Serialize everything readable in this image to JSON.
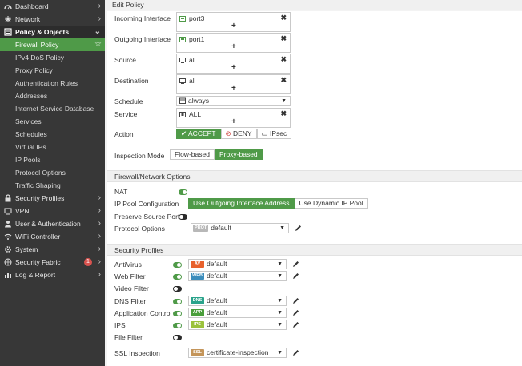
{
  "sidebar": {
    "items": [
      {
        "label": "Dashboard",
        "kind": "top",
        "icon": "dashboard-icon"
      },
      {
        "label": "Network",
        "kind": "top",
        "icon": "network-icon"
      },
      {
        "label": "Policy & Objects",
        "kind": "open",
        "icon": "policy-icon"
      },
      {
        "label": "Firewall Policy",
        "kind": "active"
      },
      {
        "label": "IPv4 DoS Policy",
        "kind": "sub"
      },
      {
        "label": "Proxy Policy",
        "kind": "sub"
      },
      {
        "label": "Authentication Rules",
        "kind": "sub"
      },
      {
        "label": "Addresses",
        "kind": "sub"
      },
      {
        "label": "Internet Service Database",
        "kind": "sub"
      },
      {
        "label": "Services",
        "kind": "sub"
      },
      {
        "label": "Schedules",
        "kind": "sub"
      },
      {
        "label": "Virtual IPs",
        "kind": "sub"
      },
      {
        "label": "IP Pools",
        "kind": "sub"
      },
      {
        "label": "Protocol Options",
        "kind": "sub"
      },
      {
        "label": "Traffic Shaping",
        "kind": "sub"
      },
      {
        "label": "Security Profiles",
        "kind": "top",
        "icon": "lock-icon"
      },
      {
        "label": "VPN",
        "kind": "top",
        "icon": "vpn-icon"
      },
      {
        "label": "User & Authentication",
        "kind": "top",
        "icon": "user-icon"
      },
      {
        "label": "WiFi Controller",
        "kind": "top",
        "icon": "wifi-icon"
      },
      {
        "label": "System",
        "kind": "top",
        "icon": "gear-icon"
      },
      {
        "label": "Security Fabric",
        "kind": "top",
        "icon": "fabric-icon",
        "badge": "1"
      },
      {
        "label": "Log & Report",
        "kind": "top",
        "icon": "chart-icon"
      }
    ]
  },
  "page": {
    "title": "Edit Policy"
  },
  "policy": {
    "incoming_label": "Incoming Interface",
    "incoming_value": "port3",
    "outgoing_label": "Outgoing Interface",
    "outgoing_value": "port1",
    "source_label": "Source",
    "source_value": "all",
    "destination_label": "Destination",
    "destination_value": "all",
    "schedule_label": "Schedule",
    "schedule_value": "always",
    "service_label": "Service",
    "service_value": "ALL",
    "action_label": "Action",
    "action_options": {
      "accept": "ACCEPT",
      "deny": "DENY",
      "ipsec": "IPsec"
    },
    "action_selected": "ACCEPT",
    "inspection_label": "Inspection Mode",
    "inspection_options": {
      "flow": "Flow-based",
      "proxy": "Proxy-based"
    },
    "inspection_selected": "Proxy-based"
  },
  "fw_options": {
    "heading": "Firewall/Network Options",
    "nat_label": "NAT",
    "nat_on": true,
    "ippool_label": "IP Pool Configuration",
    "ippool_options": {
      "outgoing": "Use Outgoing Interface Address",
      "dynamic": "Use Dynamic IP Pool"
    },
    "ippool_selected": "Use Outgoing Interface Address",
    "preserve_label": "Preserve Source Port",
    "preserve_on": false,
    "protocol_label": "Protocol Options",
    "protocol_tag": "PROT",
    "protocol_value": "default"
  },
  "security_profiles": {
    "heading": "Security Profiles",
    "antivirus": {
      "label": "AntiVirus",
      "on": true,
      "tag": "AV",
      "value": "default",
      "tag_color": "#e8612c"
    },
    "webfilter": {
      "label": "Web Filter",
      "on": true,
      "tag": "WEB",
      "value": "default",
      "tag_color": "#3c8dbc"
    },
    "videofilter": {
      "label": "Video Filter",
      "on": false
    },
    "dnsfilter": {
      "label": "DNS Filter",
      "on": true,
      "tag": "DNS",
      "value": "default",
      "tag_color": "#2aa38b"
    },
    "appcontrol": {
      "label": "Application Control",
      "on": true,
      "tag": "APP",
      "value": "default",
      "tag_color": "#4a9e3b"
    },
    "ips": {
      "label": "IPS",
      "on": true,
      "tag": "IPS",
      "value": "default",
      "tag_color": "#9bc23c"
    },
    "filefilter": {
      "label": "File Filter",
      "on": false
    },
    "ssl": {
      "label": "SSL Inspection",
      "tag": "SSL",
      "value": "certificate-inspection",
      "tag_color": "#c4955a"
    }
  },
  "colors": {
    "accent": "#4f9a48",
    "sidebar": "#373737",
    "badge": "#d9534f"
  }
}
